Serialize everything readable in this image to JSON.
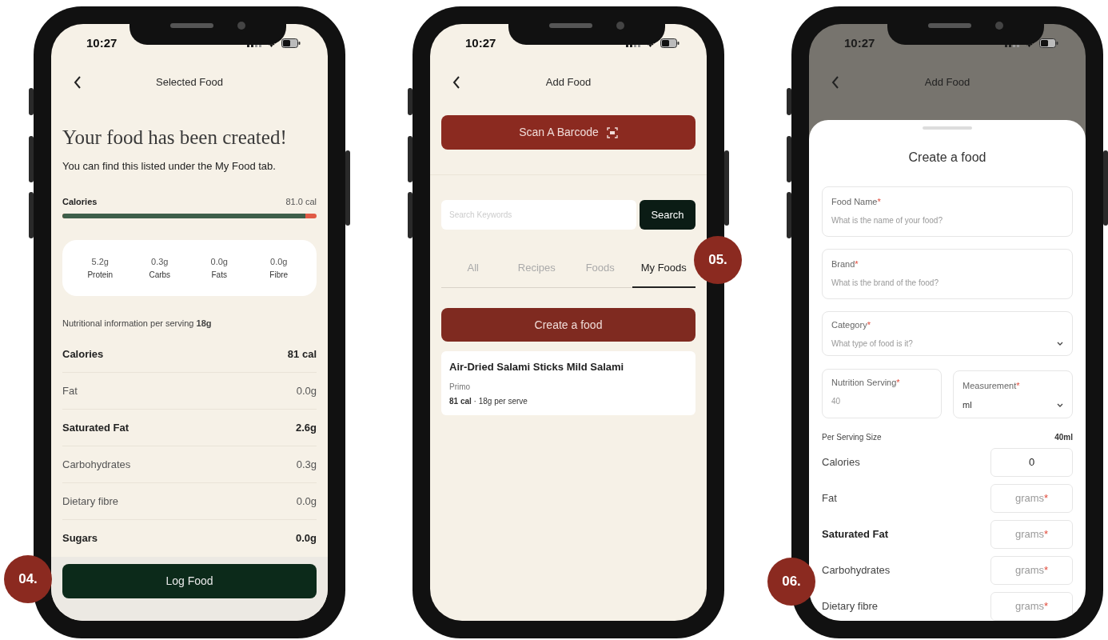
{
  "selected_food_screen": {
    "time": "10:27",
    "title": "Selected Food",
    "heading": "Your food has been created!",
    "subtitle": "You can find this listed under the My Food tab.",
    "calories_label": "Calories",
    "calories_value": "81.0 cal",
    "calories_bar": {
      "level": 0.955
    },
    "macros": [
      {
        "value": "5.2g",
        "label": "Protein"
      },
      {
        "value": "0.3g",
        "label": "Carbs"
      },
      {
        "value": "0.0g",
        "label": "Fats"
      },
      {
        "value": "0.0g",
        "label": "Fibre"
      }
    ],
    "serving_note": "Nutritional information per serving **18g**",
    "nutrients": [
      {
        "label": "Calories",
        "value": "81 cal",
        "emphasis": true
      },
      {
        "label": "Fat",
        "value": "0.0g",
        "emphasis": false
      },
      {
        "label": "Saturated Fat",
        "value": "2.6g",
        "emphasis": true
      },
      {
        "label": "Carbohydrates",
        "value": "0.3g",
        "emphasis": false
      },
      {
        "label": "Dietary fibre",
        "value": "0.0g",
        "emphasis": false
      },
      {
        "label": "Sugars",
        "value": "0.0g",
        "emphasis": true
      }
    ],
    "log_button": "Log Food"
  },
  "add_food_screen": {
    "time": "10:27",
    "title": "Add Food",
    "scan_button": "Scan A Barcode",
    "search": {
      "placeholder": "Search Keywords"
    },
    "search_button": "Search",
    "tabs": [
      {
        "label": "All",
        "selected": false
      },
      {
        "label": "Recipes",
        "selected": false
      },
      {
        "label": "Foods",
        "selected": false
      },
      {
        "label": "My Foods",
        "selected": true
      }
    ],
    "create_button": "Create a food",
    "food_card": {
      "name": "Air-Dried Salami Sticks Mild Salami",
      "brand": "Primo",
      "meta": "**81 cal** · 18g per serve"
    }
  },
  "create_food_screen": {
    "time": "10:27",
    "title": "Add Food",
    "sheet_title": "Create a food",
    "fields": [
      {
        "label": "Food Name",
        "mark": "*",
        "placeholder": "What is the name of your food?",
        "kind": "text"
      },
      {
        "label": "Brand",
        "mark": "*",
        "placeholder": "What is the brand of the food?",
        "kind": "text"
      },
      {
        "label": "Category",
        "mark": "*",
        "placeholder": "What type of food is it?",
        "kind": "select"
      }
    ],
    "serving_field": {
      "label": "Nutrition Serving",
      "mark": "*",
      "placeholder": "40"
    },
    "measurement_field": {
      "label": "Measurement",
      "mark": "*",
      "value": "ml"
    },
    "per_serving_label": "Per Serving Size",
    "per_serving_value": "40ml",
    "nutrients": [
      {
        "label": "Calories",
        "value": "0",
        "emphasis": false
      },
      {
        "label": "Fat",
        "placeholder": "grams",
        "mark": "*",
        "emphasis": false
      },
      {
        "label": "Saturated Fat",
        "placeholder": "grams",
        "mark": "*",
        "emphasis": true
      },
      {
        "label": "Carbohydrates",
        "placeholder": "grams",
        "mark": "*",
        "emphasis": false
      },
      {
        "label": "Dietary fibre",
        "placeholder": "grams",
        "mark": "*",
        "emphasis": false
      }
    ]
  },
  "step_badges": [
    "04.",
    "05.",
    "06."
  ]
}
